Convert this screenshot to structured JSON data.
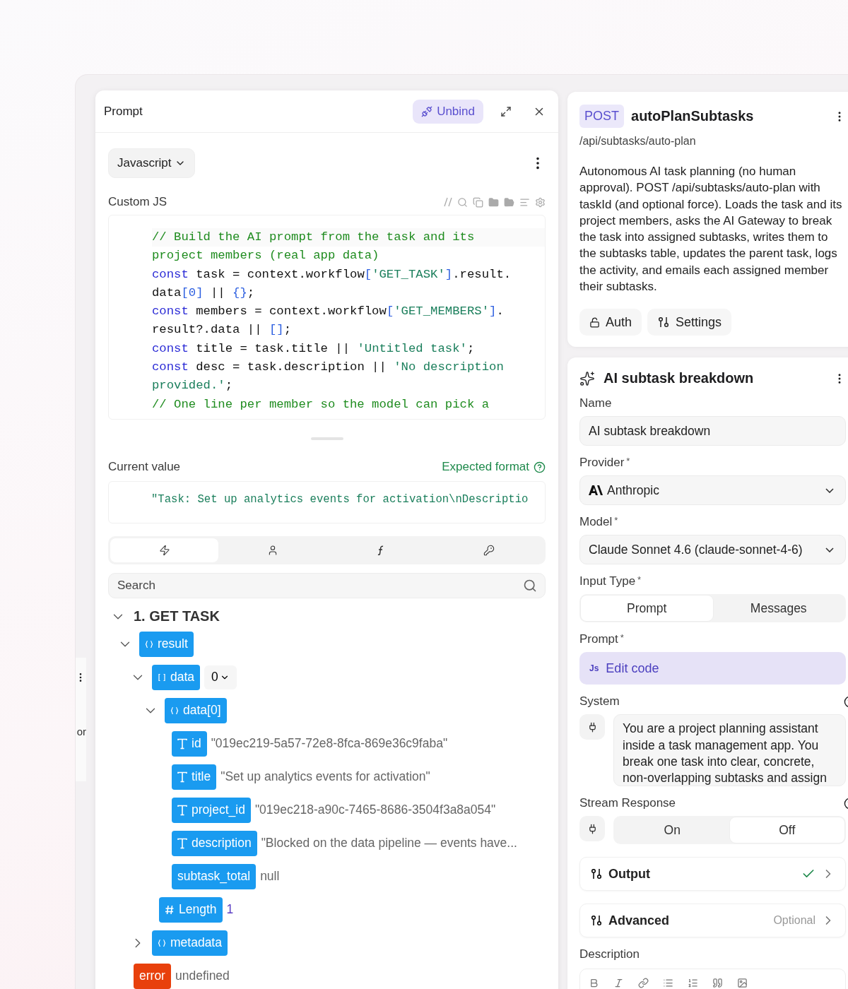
{
  "prompt_panel": {
    "title": "Prompt",
    "unbind_label": "Unbind",
    "language": "Javascript",
    "code_label": "Custom JS",
    "code_lines": [
      [
        {
          "kind": "comment",
          "text": "// Build the AI prompt from the task and its"
        }
      ],
      [
        {
          "kind": "comment",
          "text": "project members (real app data)"
        }
      ],
      [
        {
          "kind": "keyword",
          "text": "const"
        },
        {
          "kind": "plain",
          "text": " task = context.workflow"
        },
        {
          "kind": "bracket",
          "text": "["
        },
        {
          "kind": "string",
          "text": "'GET_TASK'"
        },
        {
          "kind": "bracket",
          "text": "]"
        },
        {
          "kind": "plain",
          "text": ".result."
        }
      ],
      [
        {
          "kind": "plain",
          "text": "data"
        },
        {
          "kind": "bracket",
          "text": "[0]"
        },
        {
          "kind": "plain",
          "text": " || "
        },
        {
          "kind": "bracket",
          "text": "{}"
        },
        {
          "kind": "plain",
          "text": ";"
        }
      ],
      [
        {
          "kind": "keyword",
          "text": "const"
        },
        {
          "kind": "plain",
          "text": " members = context.workflow"
        },
        {
          "kind": "bracket",
          "text": "["
        },
        {
          "kind": "string",
          "text": "'GET_MEMBERS'"
        },
        {
          "kind": "bracket",
          "text": "]"
        },
        {
          "kind": "plain",
          "text": "."
        }
      ],
      [
        {
          "kind": "plain",
          "text": "result?.data || "
        },
        {
          "kind": "bracket",
          "text": "[]"
        },
        {
          "kind": "plain",
          "text": ";"
        }
      ],
      [
        {
          "kind": "keyword",
          "text": "const"
        },
        {
          "kind": "plain",
          "text": " title = task.title || "
        },
        {
          "kind": "string",
          "text": "'Untitled task'"
        },
        {
          "kind": "plain",
          "text": ";"
        }
      ],
      [
        {
          "kind": "keyword",
          "text": "const"
        },
        {
          "kind": "plain",
          "text": " desc = task.description || "
        },
        {
          "kind": "string",
          "text": "'No description"
        }
      ],
      [
        {
          "kind": "string",
          "text": "provided.'"
        },
        {
          "kind": "plain",
          "text": ";"
        }
      ],
      [
        {
          "kind": "comment",
          "text": "// One line per member so the model can pick a"
        }
      ]
    ],
    "current_value_label": "Current value",
    "expected_format": "Expected format",
    "current_value": "\"Task: Set up analytics events for activation\\nDescriptio",
    "tabs": [
      {
        "kind": "events",
        "selected": true
      },
      {
        "kind": "user",
        "selected": false
      },
      {
        "kind": "functions",
        "selected": false
      },
      {
        "kind": "secrets",
        "selected": false
      }
    ],
    "search": {
      "placeholder": "Search"
    },
    "tree": {
      "label": "1. GET TASK",
      "expanded": true,
      "children": [
        {
          "kind": "object",
          "label": "result",
          "expanded": true,
          "children": [
            {
              "kind": "array",
              "label": "data",
              "expanded": true,
              "index": "0",
              "children": [
                {
                  "kind": "object",
                  "label": "data[0]",
                  "expanded": true,
                  "children": [
                    {
                      "kind": "text",
                      "label": "id",
                      "value": "\"019ec219-5a57-72e8-8fca-869e36c9faba\""
                    },
                    {
                      "kind": "text",
                      "label": "title",
                      "value": "\"Set up analytics events for activation\""
                    },
                    {
                      "kind": "text",
                      "label": "project_id",
                      "value": "\"019ec218-a90c-7465-8686-3504f3a8a054\""
                    },
                    {
                      "kind": "text",
                      "label": "description",
                      "value": "\"Blocked on the data pipeline — events have..."
                    },
                    {
                      "kind": "plain",
                      "label": "subtask_total",
                      "value": "null"
                    }
                  ]
                },
                {
                  "kind": "number",
                  "label": "Length",
                  "value": "1"
                }
              ]
            },
            {
              "kind": "object",
              "label": "metadata",
              "expanded": false
            }
          ]
        },
        {
          "kind": "error",
          "label": "error",
          "value": "undefined"
        }
      ]
    }
  },
  "background_fragment": {
    "text": "or"
  },
  "endpoint": {
    "method": "POST",
    "name": "autoPlanSubtasks",
    "path": "/api/subtasks/auto-plan",
    "description": "Autonomous AI task planning (no human approval). POST /api/subtasks/auto-plan with taskId (and optional force). Loads the task and its project members, asks the AI Gateway to break the task into assigned subtasks, writes them to the subtasks table, updates the parent task, logs the activity, and emails each assigned member their subtasks.",
    "buttons": [
      {
        "kind": "auth",
        "label": "Auth"
      },
      {
        "kind": "settings",
        "label": "Settings"
      }
    ]
  },
  "node": {
    "title": "AI subtask breakdown",
    "name_field": {
      "label": "Name",
      "value": "AI subtask breakdown"
    },
    "provider": {
      "label": "Provider",
      "required_mark": "*",
      "value": "Anthropic"
    },
    "model": {
      "label": "Model",
      "required_mark": "*",
      "value": "Claude Sonnet 4.6 (claude-sonnet-4-6)"
    },
    "input_type": {
      "label": "Input Type",
      "required_mark": "*",
      "options": [
        {
          "label": "Prompt",
          "selected": true
        },
        {
          "label": "Messages",
          "selected": false
        }
      ]
    },
    "prompt": {
      "label": "Prompt",
      "required_mark": "*",
      "icon_text": "Js",
      "button": "Edit code"
    },
    "system": {
      "label": "System",
      "value": "You are a project planning assistant inside a task management app. You break one task into clear, concrete, non-overlapping subtasks and assign"
    },
    "stream": {
      "label": "Stream Response",
      "options": [
        {
          "label": "On",
          "selected": false
        },
        {
          "label": "Off",
          "selected": true
        }
      ]
    },
    "sections": [
      {
        "kind": "done",
        "label": "Output"
      },
      {
        "kind": "optional",
        "label": "Advanced",
        "note": "Optional"
      }
    ],
    "description_label": "Description"
  }
}
